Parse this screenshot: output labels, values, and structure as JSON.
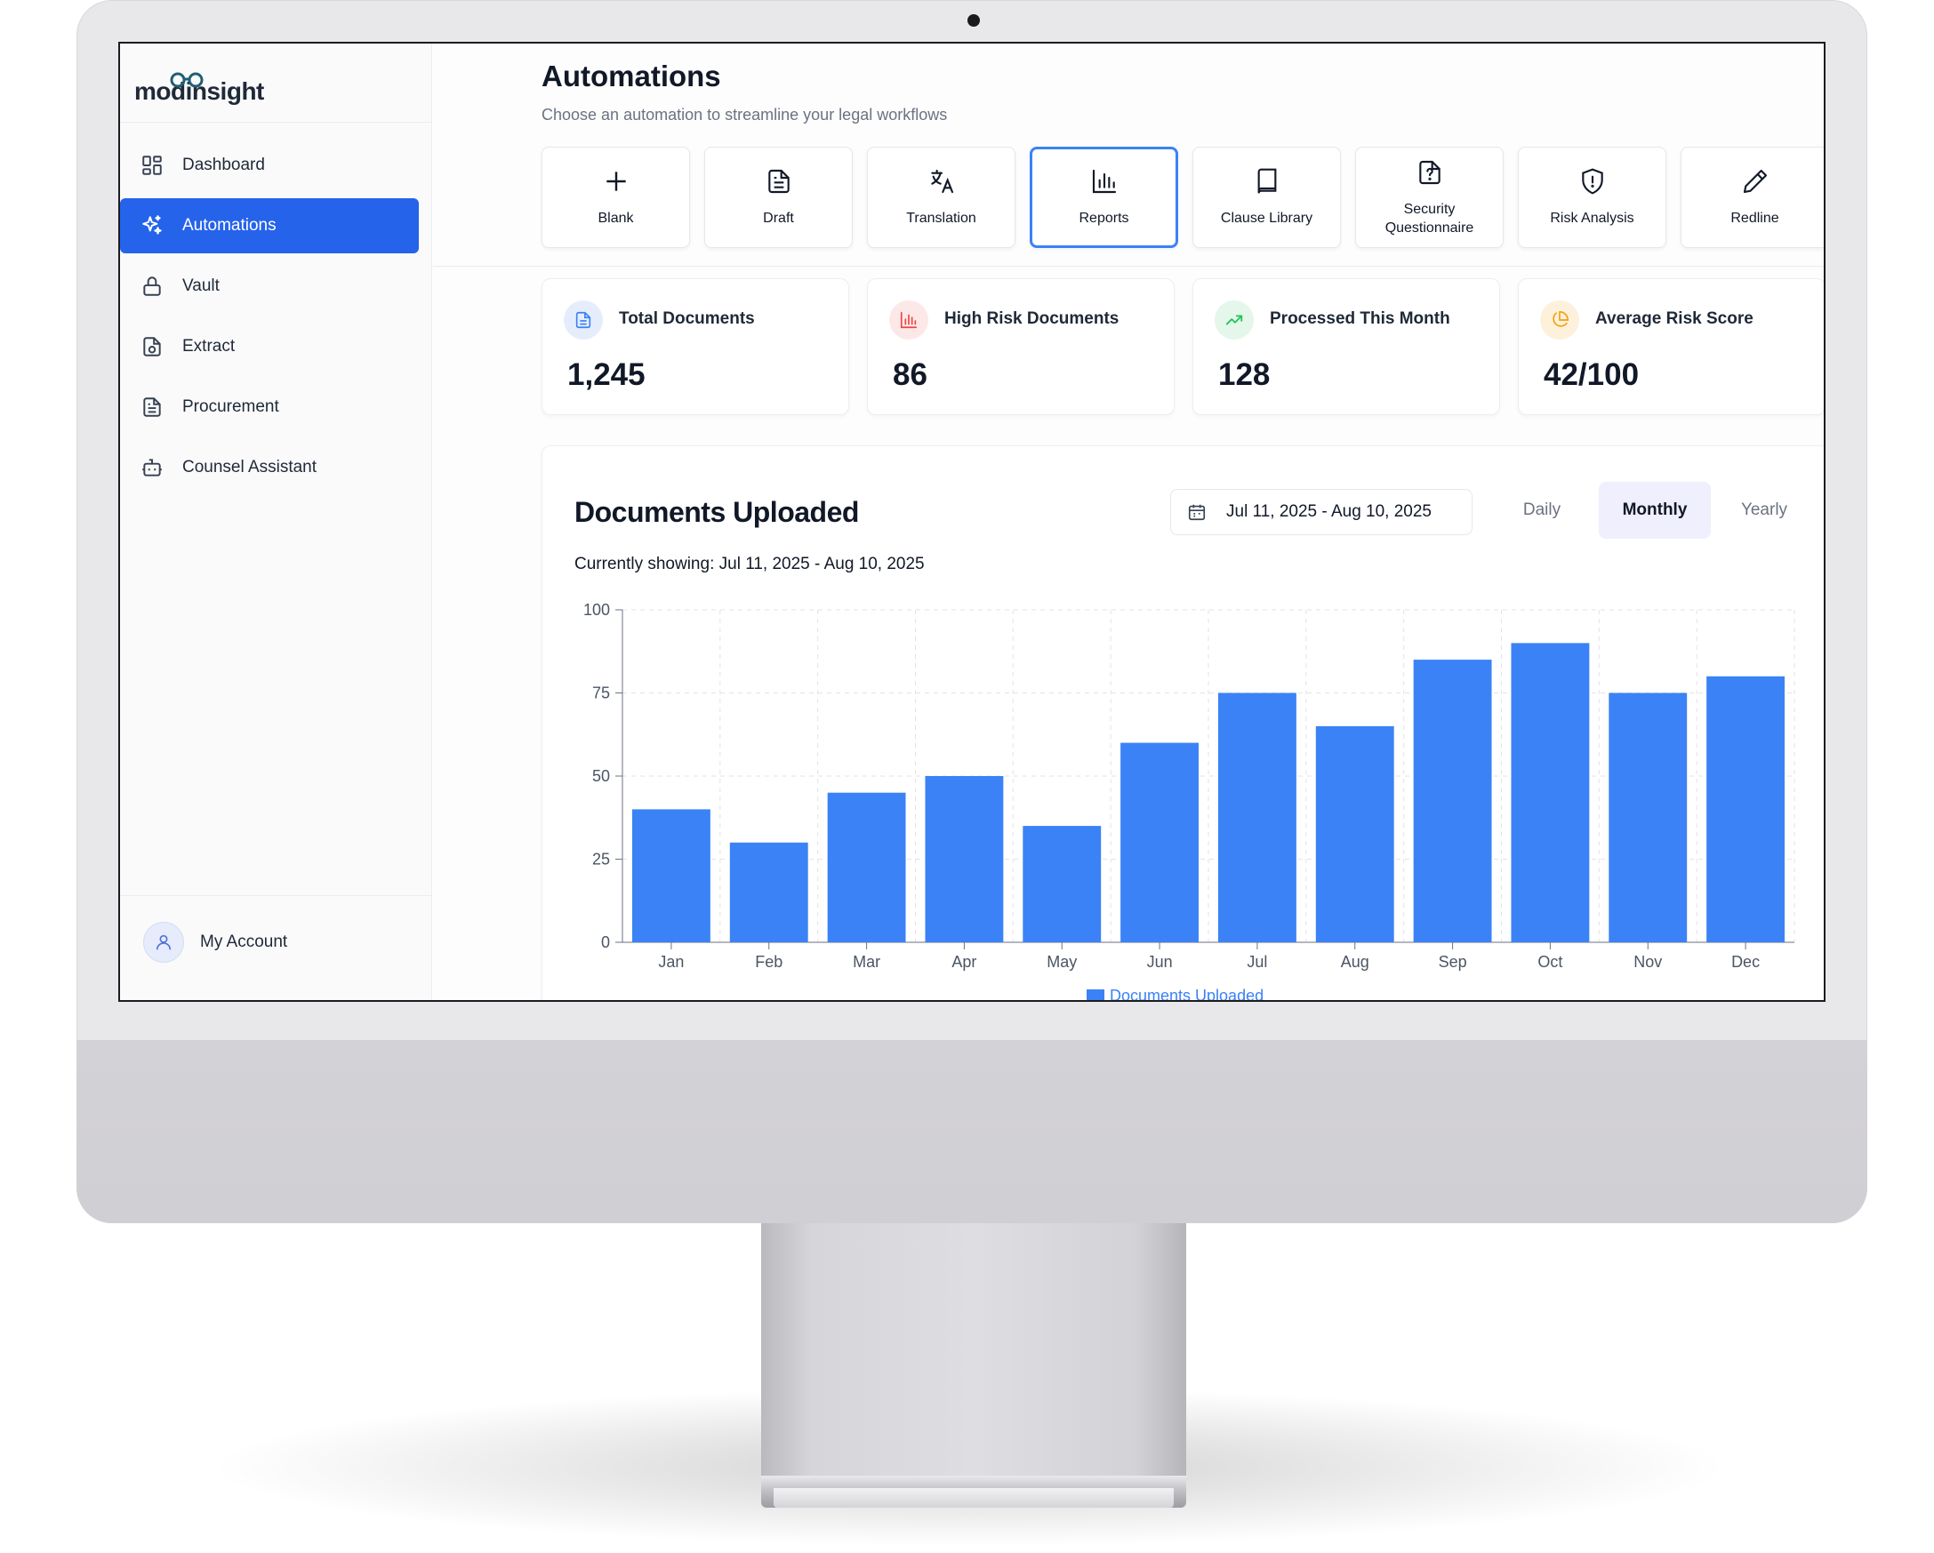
{
  "app": {
    "logo_text": "modinsight"
  },
  "sidebar": {
    "items": [
      {
        "label": "Dashboard",
        "icon": "dashboard-grid-icon"
      },
      {
        "label": "Automations",
        "icon": "sparkles-icon",
        "active": true
      },
      {
        "label": "Vault",
        "icon": "lock-icon"
      },
      {
        "label": "Extract",
        "icon": "extract-file-icon"
      },
      {
        "label": "Procurement",
        "icon": "document-list-icon"
      },
      {
        "label": "Counsel Assistant",
        "icon": "bot-icon"
      }
    ],
    "account_label": "My Account"
  },
  "header": {
    "title": "Automations",
    "subtitle": "Choose an automation to streamline your legal workflows"
  },
  "automation_tiles": [
    {
      "label": "Blank",
      "icon": "plus-icon"
    },
    {
      "label": "Draft",
      "icon": "document-icon"
    },
    {
      "label": "Translation",
      "icon": "translate-icon"
    },
    {
      "label": "Reports",
      "icon": "bar-chart-icon",
      "selected": true
    },
    {
      "label": "Clause Library",
      "icon": "book-icon"
    },
    {
      "label": "Security Questionnaire",
      "icon": "file-question-icon"
    },
    {
      "label": "Risk Analysis",
      "icon": "shield-alert-icon"
    },
    {
      "label": "Redline",
      "icon": "pencil-icon"
    }
  ],
  "stats": [
    {
      "label": "Total Documents",
      "value": "1,245",
      "icon": "document-icon",
      "color": "#3b82f6",
      "bg": "#e5edfd"
    },
    {
      "label": "High Risk Documents",
      "value": "86",
      "icon": "bar-chart-icon",
      "color": "#ef4444",
      "bg": "#fde8e8"
    },
    {
      "label": "Processed This Month",
      "value": "128",
      "icon": "trending-up-icon",
      "color": "#22c55e",
      "bg": "#e4f7ea"
    },
    {
      "label": "Average Risk Score",
      "value": "42/100",
      "icon": "pie-chart-icon",
      "color": "#f59e0b",
      "bg": "#fdf1dc"
    }
  ],
  "report": {
    "title": "Documents Uploaded",
    "caption": "Currently showing: Jul 11, 2025 - Aug 10, 2025",
    "date_range": "Jul 11, 2025 - Aug 10, 2025",
    "periods": [
      {
        "label": "Daily",
        "active": false
      },
      {
        "label": "Monthly",
        "active": true
      },
      {
        "label": "Yearly",
        "active": false
      }
    ]
  },
  "chart_data": {
    "type": "bar",
    "title": "",
    "xlabel": "",
    "ylabel": "",
    "categories": [
      "Jan",
      "Feb",
      "Mar",
      "Apr",
      "May",
      "Jun",
      "Jul",
      "Aug",
      "Sep",
      "Oct",
      "Nov",
      "Dec"
    ],
    "series": [
      {
        "name": "Documents Uploaded",
        "values": [
          40,
          30,
          45,
          50,
          35,
          60,
          75,
          65,
          85,
          90,
          75,
          80
        ],
        "color": "#3b82f6"
      }
    ],
    "ylim": [
      0,
      100
    ],
    "yticks": [
      0,
      25,
      50,
      75,
      100
    ],
    "grid": true,
    "legend": "bottom-center"
  }
}
